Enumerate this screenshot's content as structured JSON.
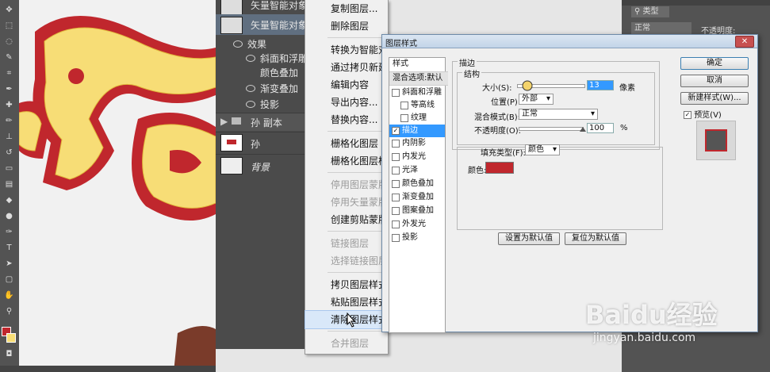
{
  "layers": [
    {
      "name": "矢量智能对象"
    },
    {
      "name": "矢量智能对象"
    },
    {
      "name": "效果"
    },
    {
      "name": "斜面和浮雕"
    },
    {
      "name": "颜色叠加"
    },
    {
      "name": "渐变叠加"
    },
    {
      "name": "投影"
    },
    {
      "name": "孙 副本"
    },
    {
      "name": "孙"
    },
    {
      "name": "背景"
    }
  ],
  "context_menu": {
    "items": [
      {
        "label": "复制图层...",
        "disabled": false
      },
      {
        "label": "删除图层",
        "disabled": false
      },
      {
        "label": "转换为智能对象",
        "disabled": false
      },
      {
        "label": "通过拷贝新建",
        "disabled": false
      },
      {
        "label": "编辑内容",
        "disabled": false
      },
      {
        "label": "导出内容...",
        "disabled": false
      },
      {
        "label": "替换内容...",
        "disabled": false
      },
      {
        "label": "栅格化图层",
        "disabled": false
      },
      {
        "label": "栅格化图层样",
        "disabled": false
      },
      {
        "label": "停用图层蒙版",
        "disabled": true
      },
      {
        "label": "停用矢量蒙版",
        "disabled": true
      },
      {
        "label": "创建剪贴蒙版",
        "disabled": false
      },
      {
        "label": "链接图层",
        "disabled": true
      },
      {
        "label": "选择链接图层",
        "disabled": true
      },
      {
        "label": "拷贝图层样式",
        "disabled": false
      },
      {
        "label": "粘贴图层样式",
        "disabled": false
      },
      {
        "label": "清除图层样式",
        "disabled": false,
        "highlighted": true
      },
      {
        "label": "合并图层",
        "disabled": true
      }
    ]
  },
  "dialog": {
    "title": "图层样式",
    "close": "✕",
    "styles_header": "样式",
    "blend_default": "混合选项:默认",
    "style_items": [
      {
        "label": "斜面和浮雕",
        "checked": false
      },
      {
        "label": "等高线",
        "checked": false
      },
      {
        "label": "纹理",
        "checked": false
      },
      {
        "label": "描边",
        "checked": true,
        "selected": true
      },
      {
        "label": "内阴影",
        "checked": false
      },
      {
        "label": "内发光",
        "checked": false
      },
      {
        "label": "光泽",
        "checked": false
      },
      {
        "label": "颜色叠加",
        "checked": false
      },
      {
        "label": "渐变叠加",
        "checked": false
      },
      {
        "label": "图案叠加",
        "checked": false
      },
      {
        "label": "外发光",
        "checked": false
      },
      {
        "label": "投影",
        "checked": false
      }
    ],
    "section_title": "描边",
    "structure_title": "结构",
    "size_label": "大小(S):",
    "size_value": "13",
    "size_unit": "像素",
    "position_label": "位置(P):",
    "position_value": "外部",
    "blend_mode_label": "混合模式(B):",
    "blend_mode_value": "正常",
    "opacity_label": "不透明度(O):",
    "opacity_value": "100",
    "opacity_unit": "%",
    "fill_type_label": "填充类型(F):",
    "fill_type_value": "颜色",
    "color_label": "颜色:",
    "stroke_color": "#c0272d",
    "set_default_button": "设置为默认值",
    "reset_default_button": "复位为默认值",
    "ok_button": "确定",
    "cancel_button": "取消",
    "new_style_button": "新建样式(W)...",
    "preview_label": "预览(V)",
    "preview_checked": true
  },
  "top_right": {
    "type_filter": "类型",
    "blend_mode": "正常",
    "opacity_label": "不透明度:"
  },
  "watermark": {
    "brand": "Baidu经验",
    "url": "jingyan.baidu.com"
  },
  "colors": {
    "toolbar": "#535353",
    "layers_panel": "#4b4b4b",
    "canvas": "#f1f1f1",
    "text_yellow": "#f7dd76",
    "text_red": "#c0272d"
  }
}
